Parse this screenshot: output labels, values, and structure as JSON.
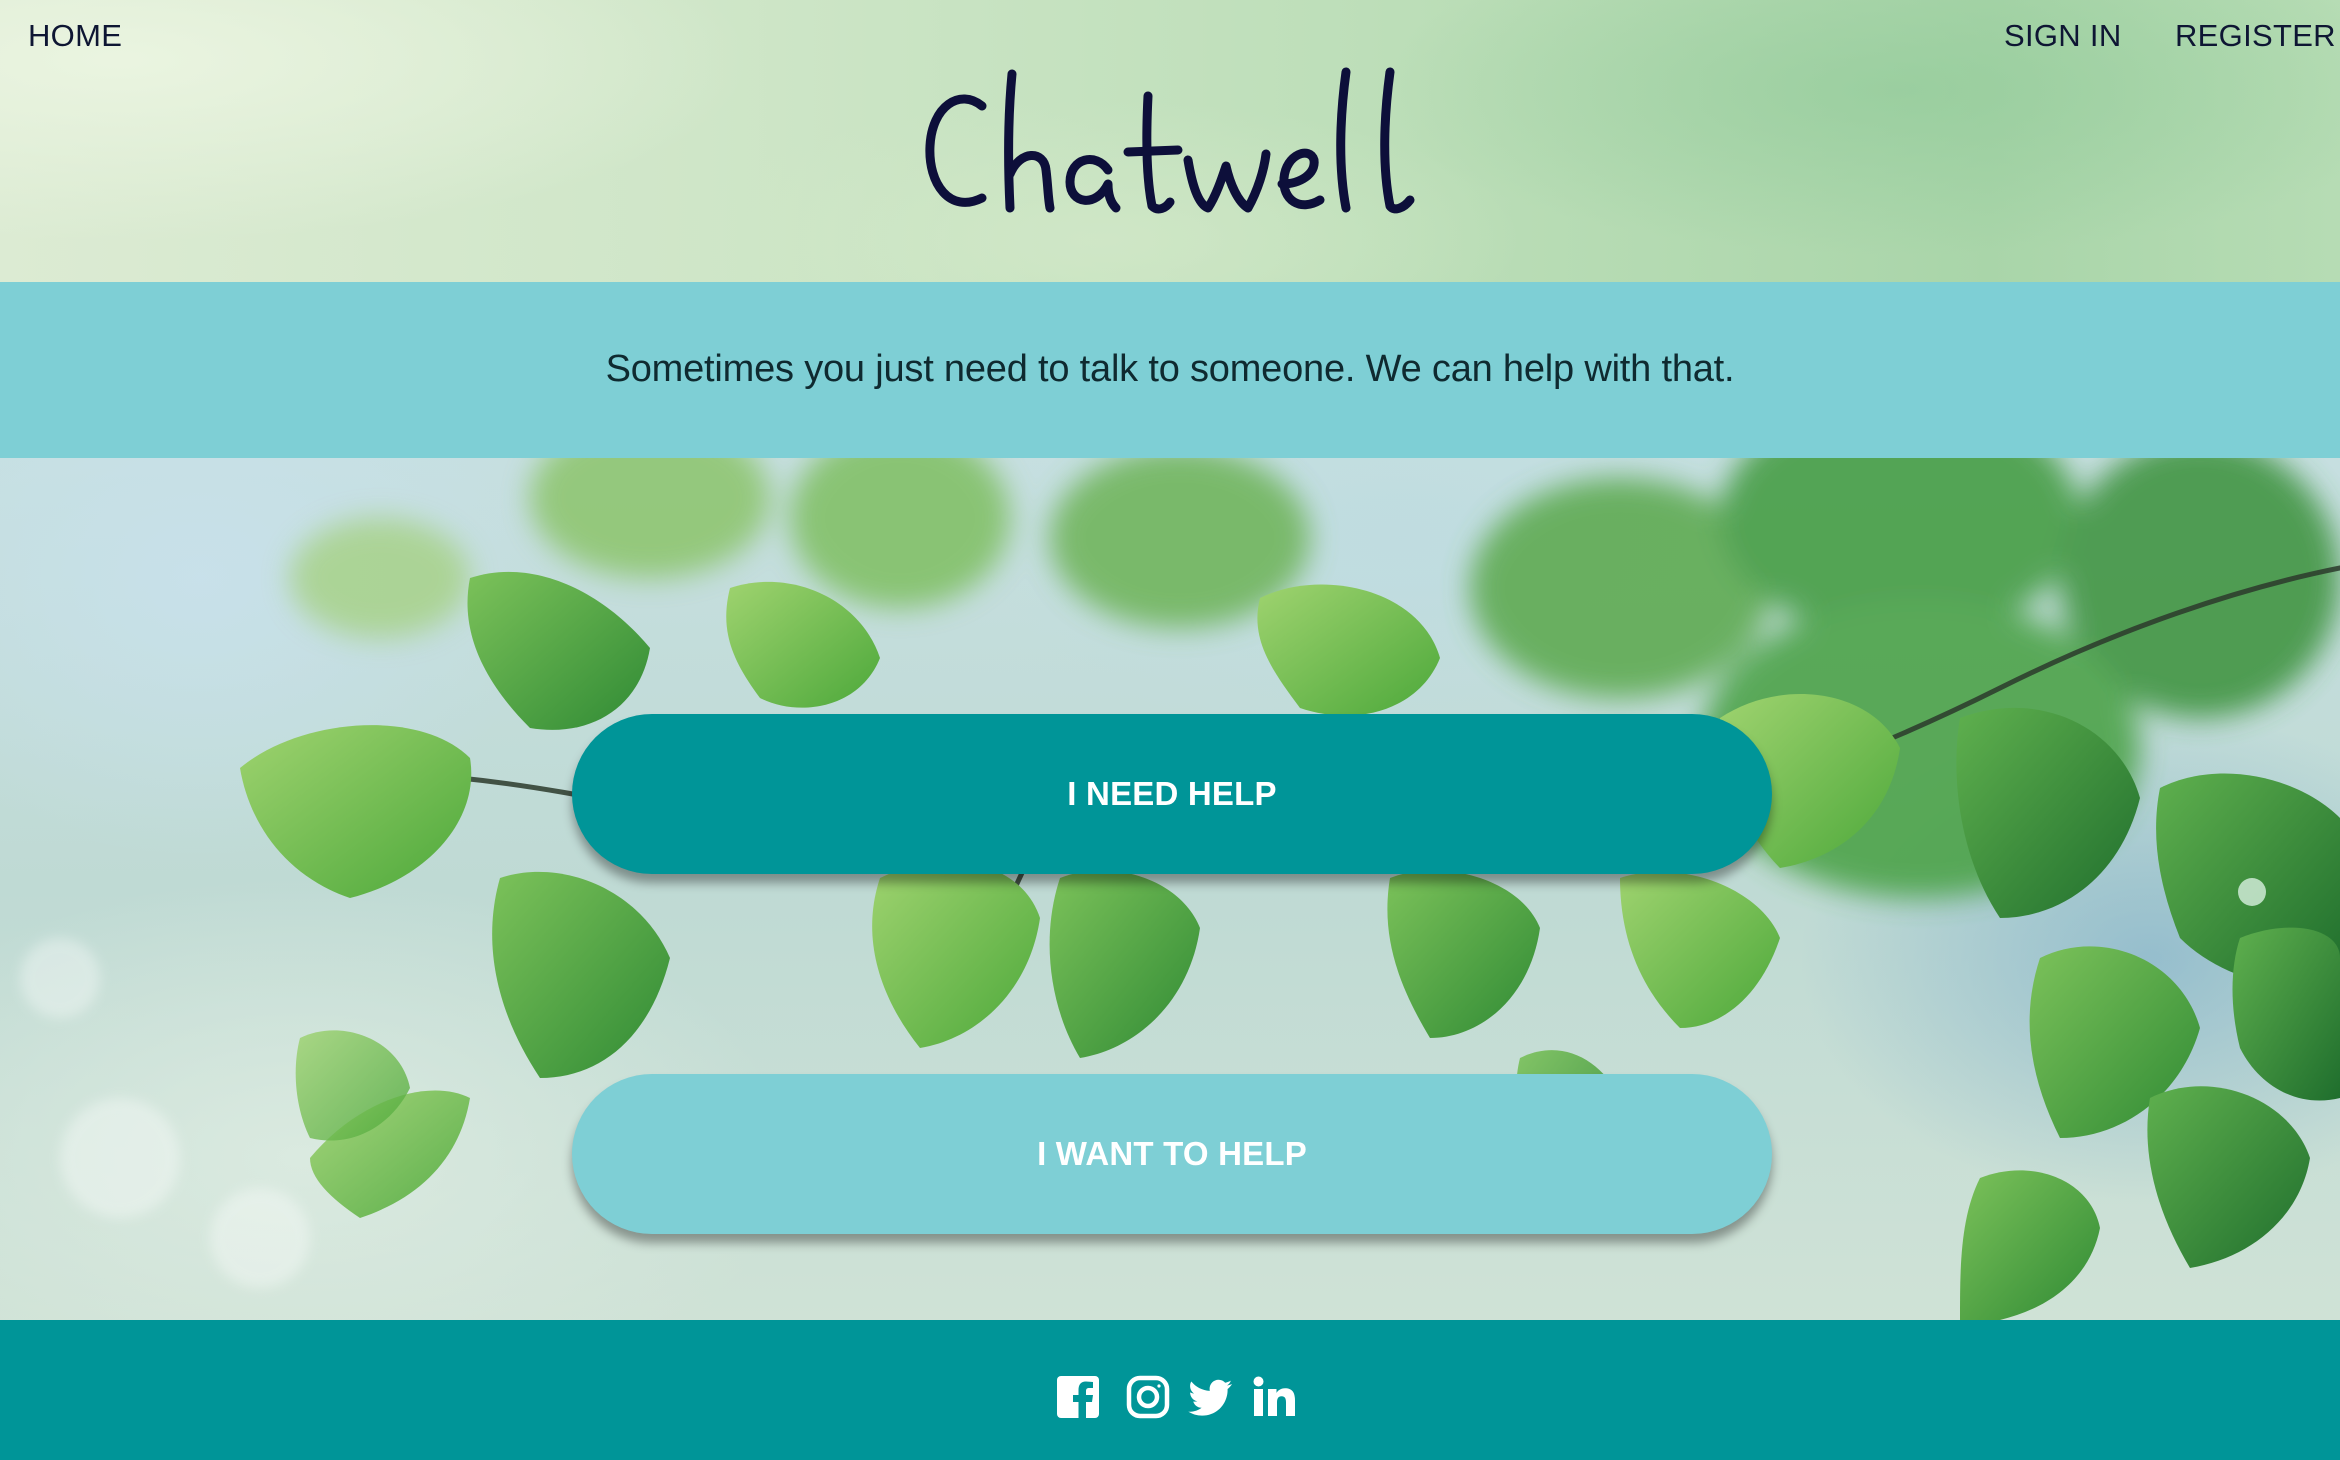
{
  "nav": {
    "home": "HOME",
    "sign_in": "SIGN IN",
    "register": "REGISTER"
  },
  "brand": {
    "logo_text": "Chatwell",
    "logo_color": "#0d0f3a"
  },
  "tagline": "Sometimes you just need to talk to someone. We can help with that.",
  "actions": {
    "need_help": "I NEED HELP",
    "want_to_help": "I WANT TO HELP"
  },
  "footer": {
    "social": [
      {
        "icon": "facebook-icon"
      },
      {
        "icon": "instagram-icon"
      },
      {
        "icon": "twitter-icon"
      },
      {
        "icon": "linkedin-icon"
      }
    ]
  },
  "colors": {
    "teal": "#009598",
    "light_teal": "#7ecfd5",
    "nav_text": "#0e1633"
  }
}
